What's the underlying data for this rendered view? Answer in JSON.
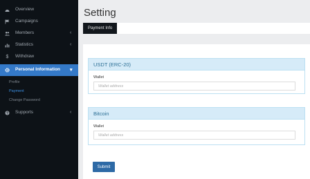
{
  "sidebar": {
    "items": [
      {
        "label": "Overview",
        "icon": "dashboard-icon"
      },
      {
        "label": "Campaigns",
        "icon": "flag-icon"
      },
      {
        "label": "Members",
        "icon": "users-icon"
      },
      {
        "label": "Statistics",
        "icon": "bar-chart-icon"
      },
      {
        "label": "Withdraw",
        "icon": "dollar-icon"
      },
      {
        "label": "Personal Information",
        "icon": "gear-icon"
      },
      {
        "label": "Supports",
        "icon": "help-icon"
      }
    ],
    "sub_items": [
      "Profile",
      "Payment",
      "Change Password"
    ]
  },
  "main": {
    "title": "Setting",
    "tab": "Payment Info",
    "panels": [
      {
        "title": "USDT (ERC-20)",
        "field_label": "Wallet",
        "placeholder": "Wallet address"
      },
      {
        "title": "Bitcoin",
        "field_label": "Wallet",
        "placeholder": "Wallet address"
      }
    ],
    "submit_label": "Submit"
  },
  "colors": {
    "sidebar_bg": "#0d1217",
    "active": "#3479c8",
    "panel_head": "#d6ebf8",
    "submit": "#2e6aa6"
  }
}
